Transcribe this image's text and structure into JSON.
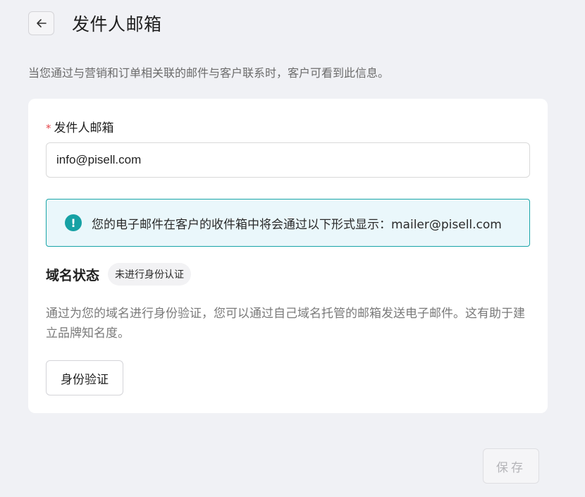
{
  "header": {
    "back_icon": "arrow-left-icon",
    "title": "发件人邮箱"
  },
  "subtitle": "当您通过与营销和订单相关联的邮件与客户联系时，客户可看到此信息。",
  "form": {
    "required_mark": "*",
    "label": "发件人邮箱",
    "email_value": "info@pisell.com"
  },
  "alert": {
    "icon": "exclamation-circle-icon",
    "color": "#16a1a4",
    "text": "您的电子邮件在客户的收件箱中将会通过以下形式显示：mailer@pisell.com"
  },
  "domain": {
    "title": "域名状态",
    "status": "未进行身份认证",
    "description": "通过为您的域名进行身份验证，您可以通过自己域名托管的邮箱发送电子邮件。这有助于建立品牌知名度。",
    "verify_label": "身份验证"
  },
  "footer": {
    "save_label": "保存"
  }
}
